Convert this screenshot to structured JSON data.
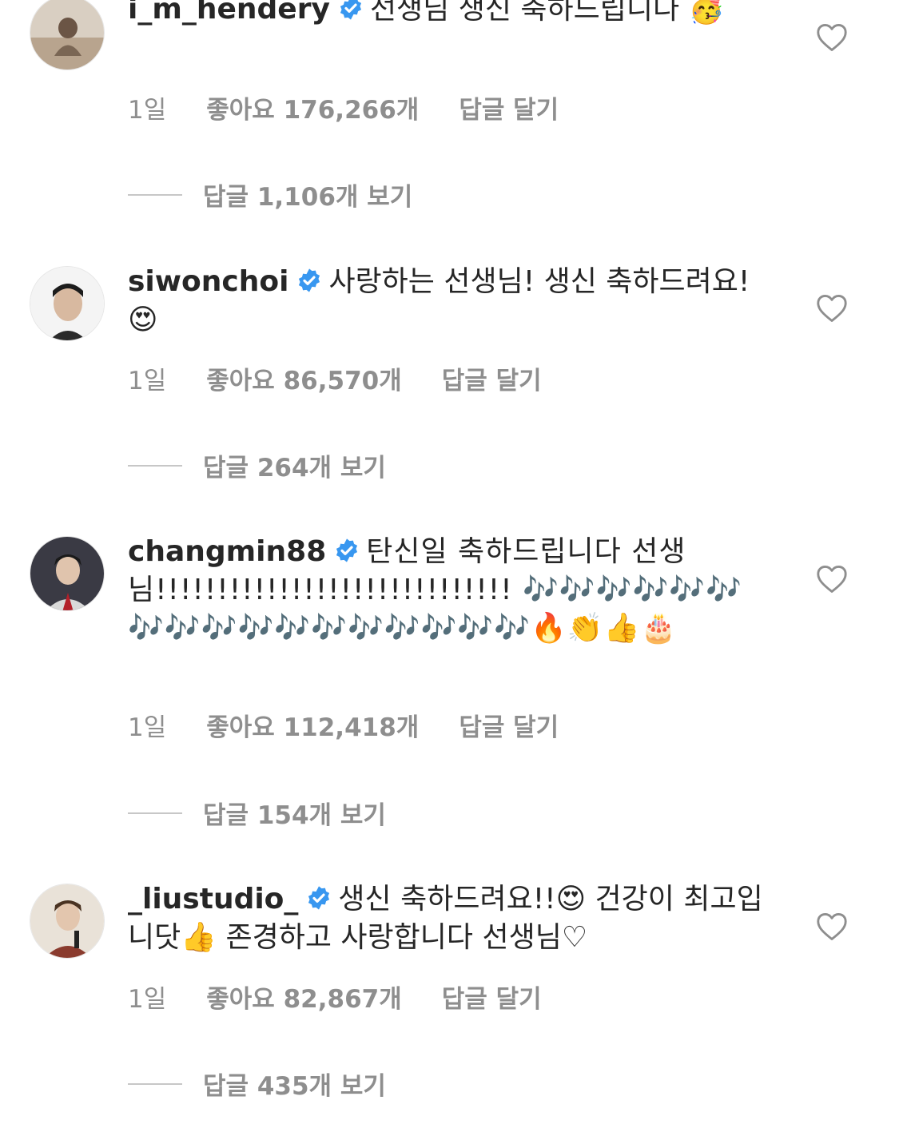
{
  "colors": {
    "text": "#262626",
    "meta": "#8e8e8e",
    "verified": "#3897f0"
  },
  "comments": [
    {
      "username": "i_m_hendery",
      "text": "선생님 생신 축하드립니다 🥳",
      "time": "1일",
      "likes": "좋아요 176,266개",
      "reply_label": "답글 달기",
      "view_replies": "답글 1,106개 보기",
      "heart_icon": "heart-outline-icon"
    },
    {
      "username": "siwonchoi",
      "text": "사랑하는 선생님! 생신 축하드려요! 😍",
      "time": "1일",
      "likes": "좋아요 86,570개",
      "reply_label": "답글 달기",
      "view_replies": "답글 264개 보기",
      "heart_icon": "heart-outline-icon"
    },
    {
      "username": "changmin88",
      "text": "탄신일 축하드립니다 선생님!!!!!!!!!!!!!!!!!!!!!!!!!!!!! 🎶🎶🎶🎶🎶🎶🎶🎶🎶🎶🎶🎶🎶🎶🎶🎶🎶🔥👏👍🎂",
      "time": "1일",
      "likes": "좋아요 112,418개",
      "reply_label": "답글 달기",
      "view_replies": "답글 154개 보기",
      "heart_icon": "heart-outline-icon"
    },
    {
      "username": "_liustudio_",
      "text": "생신 축하드려요!!😍 건강이 최고입니닷👍 존경하고 사랑합니다 선생님♡",
      "time": "1일",
      "likes": "좋아요 82,867개",
      "reply_label": "답글 달기",
      "view_replies": "답글 435개 보기",
      "heart_icon": "heart-outline-icon"
    }
  ]
}
